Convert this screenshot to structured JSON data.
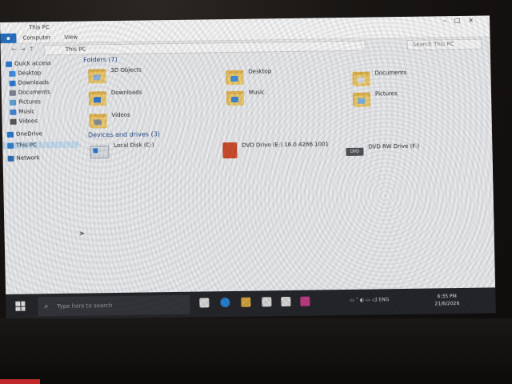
{
  "window": {
    "title": "This PC",
    "tabs": [
      "Computer",
      "View"
    ],
    "path": "This PC",
    "search_placeholder": "Search This PC"
  },
  "sidebar": {
    "items": [
      {
        "label": "Quick access",
        "icon": "star-icon",
        "color": "#2a78d6"
      },
      {
        "label": "Desktop",
        "icon": "desktop-icon",
        "color": "#3a8ee6"
      },
      {
        "label": "Downloads",
        "icon": "download-icon",
        "color": "#2a78d6"
      },
      {
        "label": "Documents",
        "icon": "document-icon",
        "color": "#7a8593"
      },
      {
        "label": "Pictures",
        "icon": "picture-icon",
        "color": "#5aa3dc"
      },
      {
        "label": "Music",
        "icon": "music-icon",
        "color": "#3b86d8"
      },
      {
        "label": "Videos",
        "icon": "video-icon",
        "color": "#555"
      },
      {
        "label": "OneDrive",
        "icon": "cloud-icon",
        "color": "#1e78d6"
      },
      {
        "label": "This PC",
        "icon": "computer-icon",
        "color": "#2f7fd4"
      },
      {
        "label": "Network",
        "icon": "network-icon",
        "color": "#2a6fb8"
      }
    ]
  },
  "main": {
    "folders_header": "Folders (7)",
    "folders": [
      {
        "label": "3D Objects",
        "badge": "#8fb8e8"
      },
      {
        "label": "Desktop",
        "badge": "#3a8ee6"
      },
      {
        "label": "Documents",
        "badge": "#dfe3e8"
      },
      {
        "label": "Downloads",
        "badge": "#2a78d6"
      },
      {
        "label": "Music",
        "badge": "#3b86d8"
      },
      {
        "label": "Pictures",
        "badge": "#7ab5e6"
      },
      {
        "label": "Videos",
        "badge": "#8a8f96"
      }
    ],
    "devices_header": "Devices and drives (3)",
    "drives": [
      {
        "label": "Local Disk (C:)",
        "sub": ""
      },
      {
        "label": "DVD Drive (E:) 16.0.4266.1001",
        "sub": ""
      },
      {
        "label": "DVD RW Drive (F:)",
        "sub": ""
      }
    ]
  },
  "taskbar": {
    "search_placeholder": "Type here to search",
    "language": "ENG",
    "time": "6:35 PM",
    "date": "21/6/2026"
  }
}
